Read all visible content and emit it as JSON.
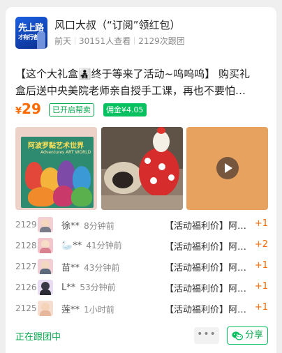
{
  "header": {
    "avatar_text_line1": "先上路",
    "avatar_text_line2": "才有行者",
    "title": "风口大叔（“订阅”领红包）",
    "posted": "前天",
    "views": "30151人查看",
    "joined": "2129次跟团"
  },
  "description": {
    "line1": "【这个大礼盒👨‍👧‍👦终于等来了活动~呜呜呜】 购买礼",
    "line2": "盒后送中央美院老师亲自授手工课，再也不要怕…"
  },
  "price": {
    "currency": "¥",
    "value": "29",
    "tag_helper": "已开启帮卖",
    "tag_commission": "佣金¥4.05"
  },
  "images": {
    "book_title": "阿波罗黏艺术世界",
    "book_subtitle": "Adventures ART WORLD"
  },
  "orders": [
    {
      "no": "2129",
      "name": "徐**",
      "time": "8分钟前",
      "item": "【活动福利价】阿波罗黏土礼盒",
      "qty": "+1"
    },
    {
      "no": "2128",
      "name": "🦢**",
      "time": "41分钟前",
      "item": "【活动福利价】阿波罗黏土礼盒",
      "qty": "+2"
    },
    {
      "no": "2127",
      "name": "苗**",
      "time": "43分钟前",
      "item": "【活动福利价】阿波罗黏土礼盒",
      "qty": "+1"
    },
    {
      "no": "2126",
      "name": "L**",
      "time": "53分钟前",
      "item": "【活动福利价】阿波罗黏土礼盒",
      "qty": "+1"
    },
    {
      "no": "2125",
      "name": "莲**",
      "time": "1小时前",
      "item": "【活动福利价】阿波罗黏土礼盒",
      "qty": "+1"
    }
  ],
  "footer": {
    "status": "正在跟团中",
    "more": "•••",
    "share": "分享"
  },
  "colors": {
    "accent_green": "#07c160",
    "price_orange": "#ff6a00"
  },
  "icons": [
    "wechat-icon",
    "play-icon",
    "more-icon"
  ]
}
